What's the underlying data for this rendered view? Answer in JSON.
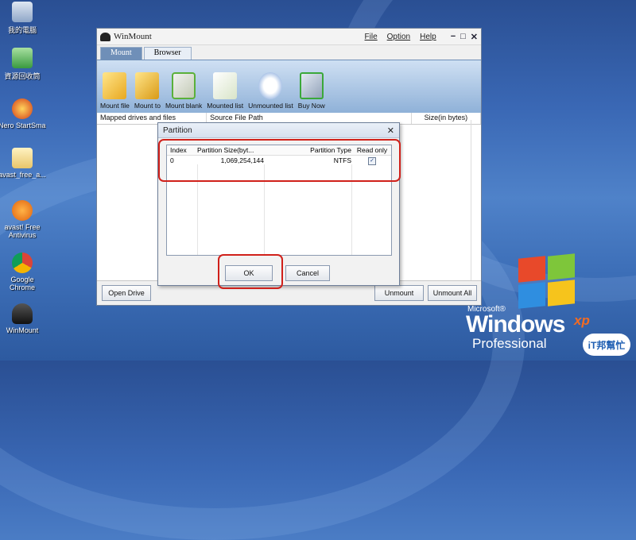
{
  "desktop": {
    "icons": [
      {
        "label": "我的電腦",
        "icon": "computer-icon"
      },
      {
        "label": "資源回收筒",
        "icon": "recycle-bin-icon"
      },
      {
        "label": "Nero StartSmart",
        "icon": "nero-icon"
      },
      {
        "label": "avast_free_a...",
        "icon": "file-icon"
      },
      {
        "label": "avast! Free Antivirus",
        "icon": "avast-icon"
      },
      {
        "label": "Google Chrome",
        "icon": "chrome-icon"
      },
      {
        "label": "WinMount",
        "icon": "winmount-icon"
      }
    ],
    "logo_brand": "Microsoft®",
    "logo_main": "Windows",
    "logo_xp": "xp",
    "logo_edition": "Professional",
    "badge": "iT邦幫忙"
  },
  "window": {
    "title": "WinMount",
    "menu": [
      "File",
      "Option",
      "Help"
    ],
    "tabs": [
      "Mount",
      "Browser"
    ],
    "toolbar": [
      "Mount file",
      "Mount to",
      "Mount blank",
      "Mounted list",
      "Unmounted list",
      "Buy Now"
    ],
    "columns": [
      "Mapped drives and files",
      "Source File Path",
      "Size(in bytes)"
    ],
    "buttons": {
      "open_drive": "Open Drive",
      "unmount": "Unmount",
      "unmount_all": "Unmount All"
    }
  },
  "dialog": {
    "title": "Partition",
    "columns": [
      "Index",
      "Partition Size(byt...",
      "Partition Type",
      "Read only"
    ],
    "rows": [
      {
        "index": "0",
        "size": "1,069,254,144",
        "type": "NTFS",
        "read_only": true
      }
    ],
    "ok": "OK",
    "cancel": "Cancel"
  }
}
